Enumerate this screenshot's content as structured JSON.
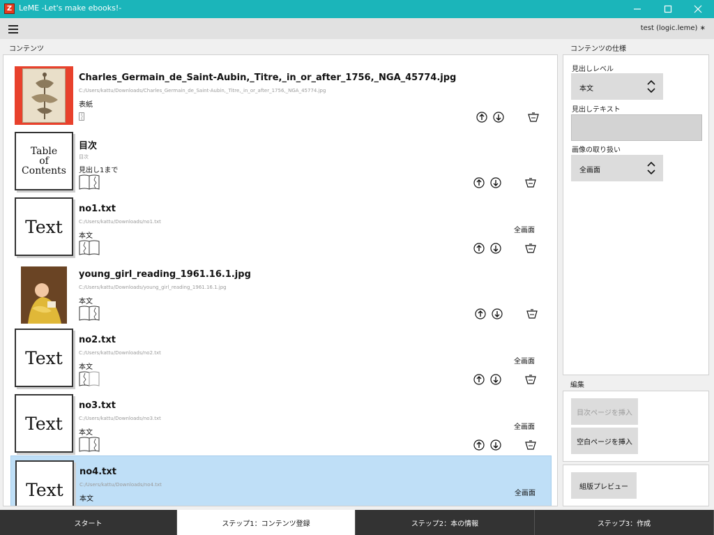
{
  "window": {
    "title": "LeME -Let's make ebooks!-",
    "logo_letter": "Z"
  },
  "appbar": {
    "user": "test (logic.leme) ∗"
  },
  "contents": {
    "label": "コンテンツ",
    "items": [
      {
        "name": "Charles_Germain_de_Saint-Aubin,_Titre,_in_or_after_1756,_NGA_45774.jpg",
        "path": "C:/Users/kattu/Downloads/Charles_Germain_de_Saint-Aubin,_Titre,_in_or_after_1756,_NGA_45774.jpg",
        "level": "表紙",
        "mode": "",
        "thumb": "image-ornament",
        "book": "single-page-icon"
      },
      {
        "name": "目次",
        "path": "目次",
        "level": "見出し1まで",
        "mode": "",
        "thumb": "toc",
        "thumb_lines": [
          "Table",
          "of",
          "Contents"
        ],
        "book": "open-book-icon"
      },
      {
        "name": "no1.txt",
        "path": "C:/Users/kattu/Downloads/no1.txt",
        "level": "本文",
        "mode": "全画面",
        "thumb": "text",
        "thumb_text": "Text",
        "book": "open-book-icon"
      },
      {
        "name": "young_girl_reading_1961.16.1.jpg",
        "path": "C:/Users/kattu/Downloads/young_girl_reading_1961.16.1.jpg",
        "level": "本文",
        "mode": "",
        "thumb": "image-painting",
        "book": "open-book-icon"
      },
      {
        "name": "no2.txt",
        "path": "C:/Users/kattu/Downloads/no2.txt",
        "level": "本文",
        "mode": "全画面",
        "thumb": "text",
        "thumb_text": "Text",
        "book": "open-book-icon"
      },
      {
        "name": "no3.txt",
        "path": "C:/Users/kattu/Downloads/no3.txt",
        "level": "本文",
        "mode": "全画面",
        "thumb": "text",
        "thumb_text": "Text",
        "book": "open-book-icon"
      },
      {
        "name": "no4.txt",
        "path": "C:/Users/kattu/Downloads/no4.txt",
        "level": "本文",
        "mode": "全画面",
        "thumb": "text",
        "thumb_text": "Text",
        "book": "open-book-icon",
        "selected": true
      }
    ]
  },
  "spec": {
    "label": "コンテンツの仕様",
    "heading_level_label": "見出しレベル",
    "heading_level_value": "本文",
    "heading_text_label": "見出しテキスト",
    "heading_text_value": "",
    "image_handling_label": "画像の取り扱い",
    "image_handling_value": "全画面"
  },
  "edit": {
    "label": "編集",
    "insert_toc": "目次ページを挿入",
    "insert_blank": "空白ページを挿入"
  },
  "preview": {
    "label": "組版プレビュー"
  },
  "tabs": [
    {
      "label": "スタート",
      "active": false
    },
    {
      "label": "ステップ1：コンテンツ登録",
      "active": true
    },
    {
      "label": "ステップ2：本の情報",
      "active": false
    },
    {
      "label": "ステップ3：作成",
      "active": false
    }
  ],
  "colors": {
    "titlebar": "#1bb5ba",
    "selection": "#bfdff7",
    "tab_dark": "#333333",
    "cover_frame": "#e8412c"
  }
}
